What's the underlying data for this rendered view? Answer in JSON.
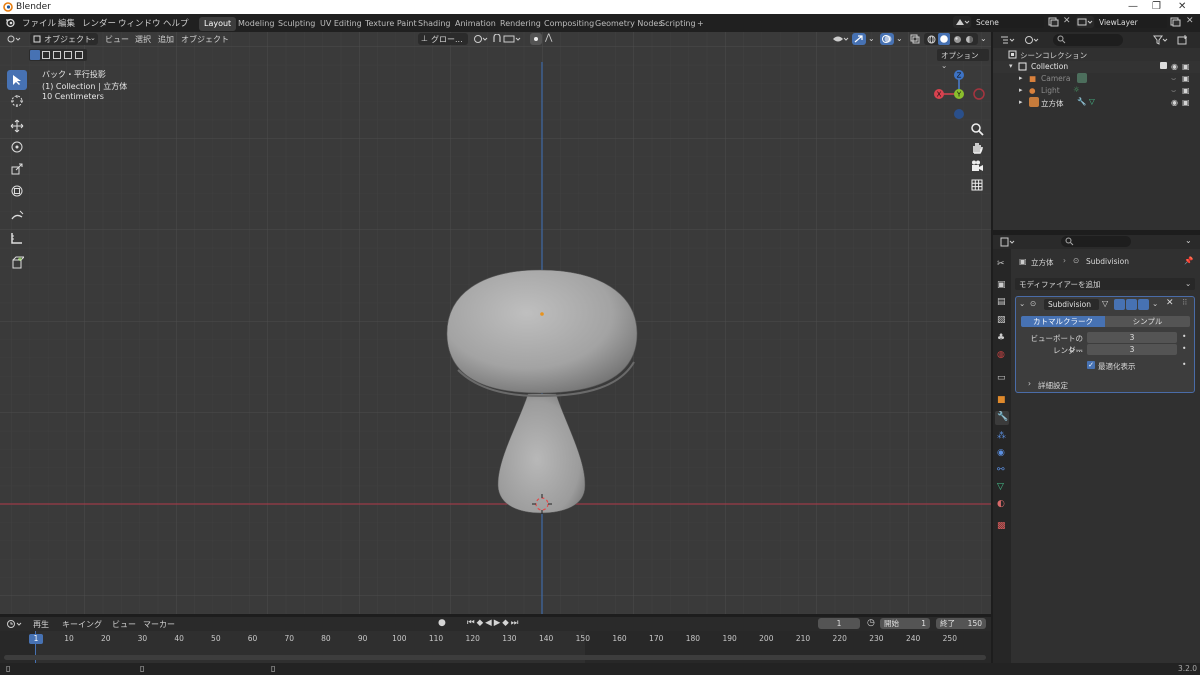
{
  "window": {
    "title": "Blender",
    "controls": [
      "—",
      "❐",
      "✕"
    ]
  },
  "menubar": [
    "ファイル",
    "編集",
    "レンダー",
    "ウィンドウ",
    "ヘルプ"
  ],
  "workspaces": [
    "Layout",
    "Modeling",
    "Sculpting",
    "UV Editing",
    "Texture Paint",
    "Shading",
    "Animation",
    "Rendering",
    "Compositing",
    "Geometry Nodes",
    "Scripting",
    "+"
  ],
  "scene": {
    "scene_name": "Scene",
    "view_layer": "ViewLayer"
  },
  "viewport": {
    "mode": "オブジェクト",
    "menus": [
      "ビュー",
      "選択",
      "追加",
      "オブジェクト"
    ],
    "orientation": "グロー...",
    "options": "オプション",
    "info": [
      "バック・平行投影",
      "(1) Collection | 立方体",
      "10 Centimeters"
    ],
    "gizmo": {
      "z": "Z",
      "y": "Y",
      "x": "X"
    }
  },
  "outliner": {
    "title": "シーンコレクション",
    "items": [
      {
        "label": "Collection"
      },
      {
        "label": "Camera"
      },
      {
        "label": "Light"
      },
      {
        "label": "立方体"
      }
    ]
  },
  "properties": {
    "breadcrumb_object": "立方体",
    "breadcrumb_modifier": "Subdivision",
    "add_modifier": "モディファイアーを追加",
    "modifier_name": "Subdivision",
    "type_catmull": "カトマルクラーク",
    "type_simple": "シンプル",
    "viewport_label": "ビューポートのレ...",
    "viewport_value": "3",
    "render_label": "レンダー",
    "render_value": "3",
    "optimal_label": "最適化表示",
    "advanced_label": "詳細設定"
  },
  "timeline": {
    "menus": [
      "再生",
      "キーイング",
      "ビュー",
      "マーカー"
    ],
    "current_frame": "1",
    "start_label": "開始",
    "start_value": "1",
    "end_label": "終了",
    "end_value": "150",
    "ticks": [
      "1",
      "10",
      "20",
      "30",
      "40",
      "50",
      "60",
      "70",
      "80",
      "90",
      "100",
      "110",
      "120",
      "130",
      "140",
      "150",
      "160",
      "170",
      "180",
      "190",
      "200",
      "210",
      "220",
      "230",
      "240",
      "250"
    ]
  },
  "status": {
    "version": "3.2.0"
  }
}
